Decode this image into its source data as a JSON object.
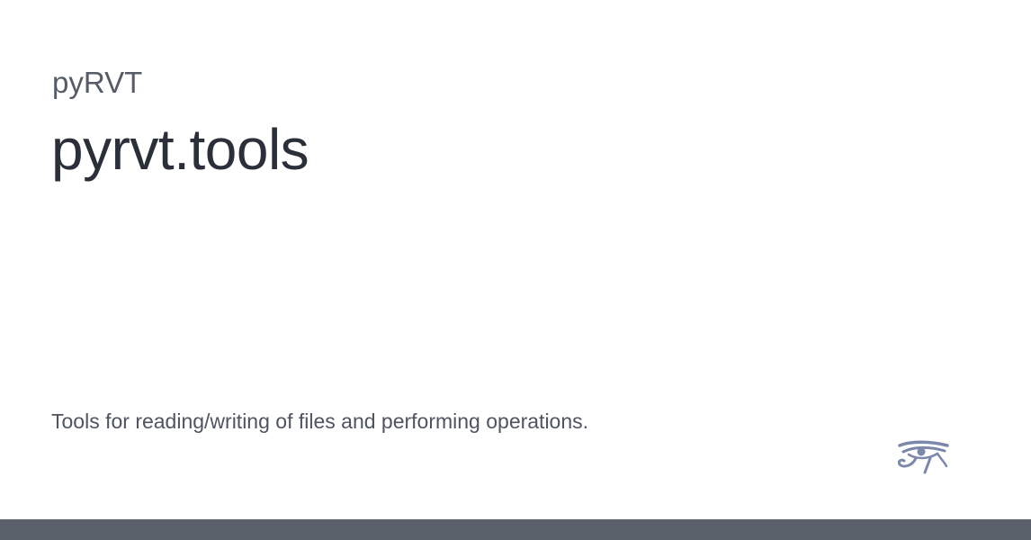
{
  "header": {
    "project_name": "pyRVT",
    "module_title": "pyrvt.tools"
  },
  "main": {
    "description": "Tools for reading/writing of files and performing operations."
  },
  "logo": {
    "icon": "eye-of-horus-icon",
    "color": "#7c88ab"
  },
  "footer": {
    "bar_color": "#5b616b"
  }
}
